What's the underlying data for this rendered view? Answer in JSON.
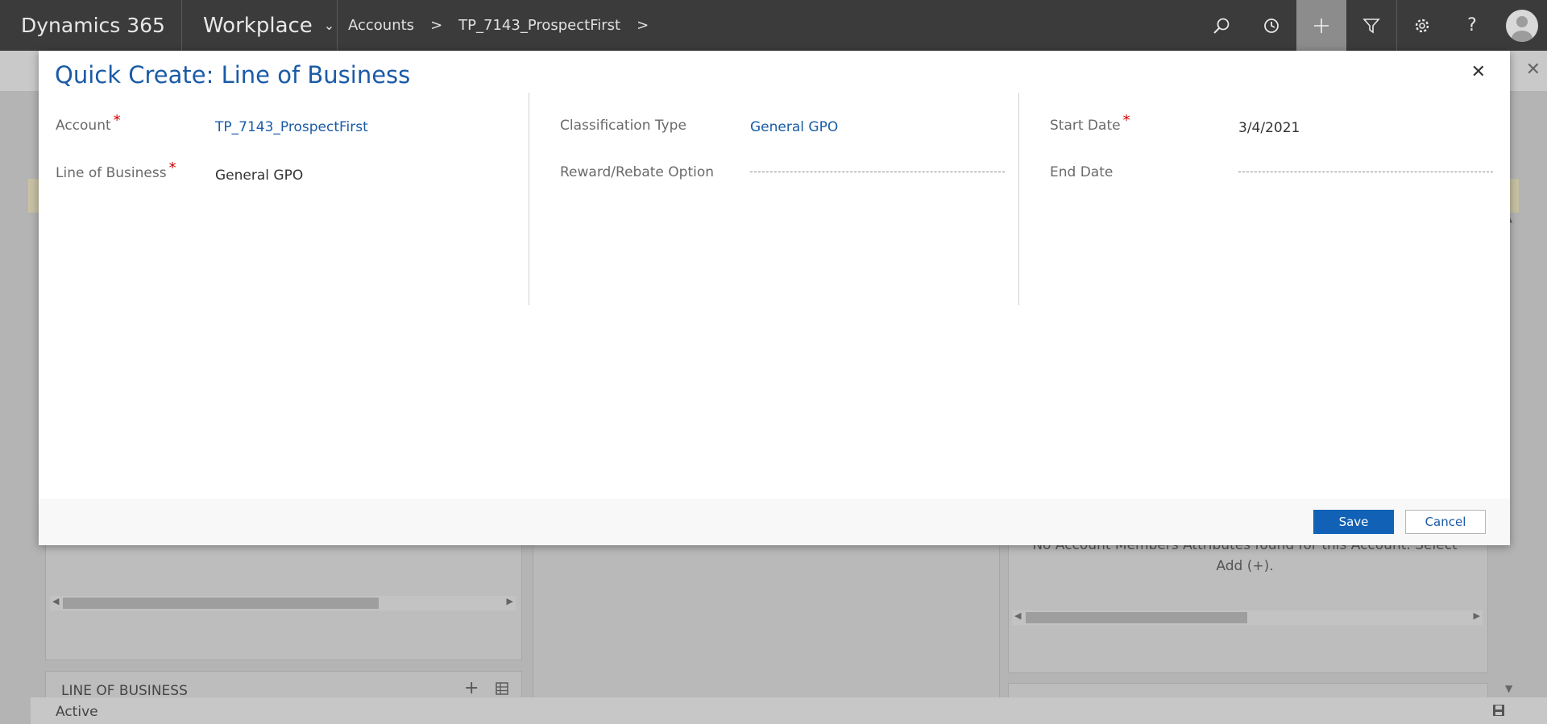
{
  "nav": {
    "brand": "Dynamics 365",
    "app": "Workplace",
    "breadcrumb": [
      "Accounts",
      "TP_7143_ProspectFirst"
    ],
    "icons": [
      "search-icon",
      "history-icon",
      "plus-icon",
      "filter-icon",
      "gear-icon",
      "help-icon",
      "avatar"
    ]
  },
  "modal": {
    "title": "Quick Create: Line of Business",
    "fields": {
      "account": {
        "label": "Account",
        "value": "TP_7143_ProspectFirst",
        "required": true
      },
      "line_of_business": {
        "label": "Line of Business",
        "value": "General GPO",
        "required": true
      },
      "classification_type": {
        "label": "Classification Type",
        "value": "General GPO"
      },
      "reward_rebate": {
        "label": "Reward/Rebate Option",
        "value": ""
      },
      "start_date": {
        "label": "Start Date",
        "value": "3/4/2021",
        "required": true
      },
      "end_date": {
        "label": "End Date",
        "value": ""
      }
    },
    "save_label": "Save",
    "cancel_label": "Cancel"
  },
  "background": {
    "section_title": "LINE OF BUSINESS",
    "status": "Active",
    "empty_message": "No Account Members Attributes found for this Account. Select Add (+)."
  }
}
